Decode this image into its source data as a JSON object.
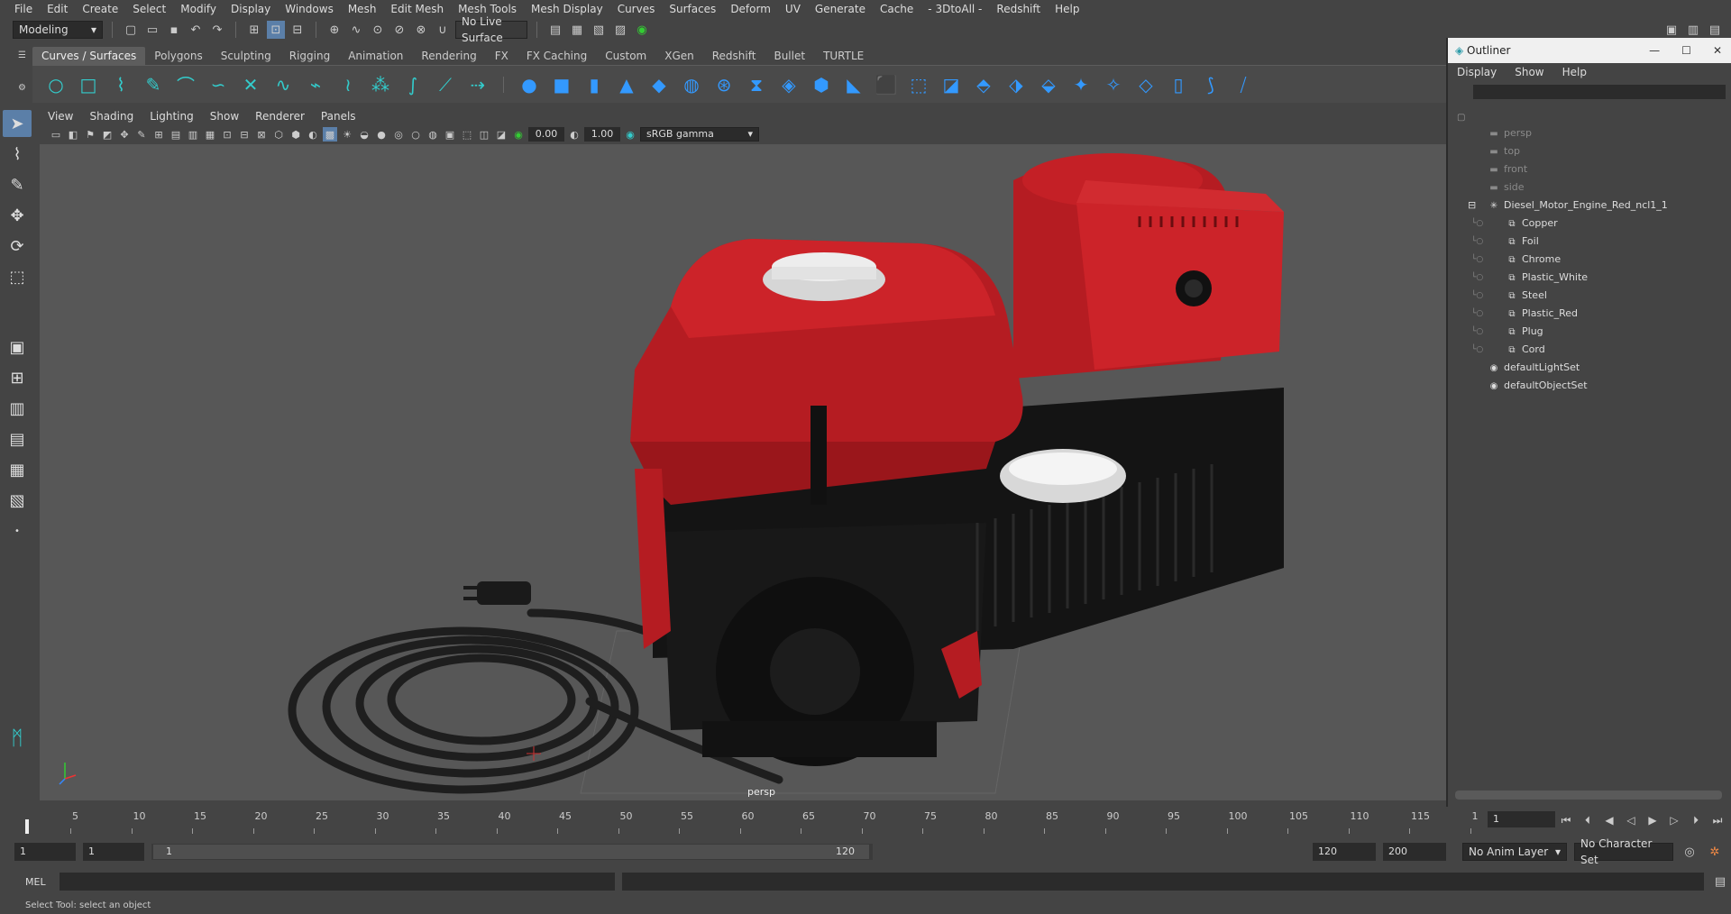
{
  "menubar": [
    "File",
    "Edit",
    "Create",
    "Select",
    "Modify",
    "Display",
    "Windows",
    "Mesh",
    "Edit Mesh",
    "Mesh Tools",
    "Mesh Display",
    "Curves",
    "Surfaces",
    "Deform",
    "UV",
    "Generate",
    "Cache",
    "- 3DtoAll -",
    "Redshift",
    "Help"
  ],
  "statusline": {
    "mode": "Modeling",
    "live_surface": "No Live Surface"
  },
  "shelf_tabs": [
    "Curves / Surfaces",
    "Polygons",
    "Sculpting",
    "Rigging",
    "Animation",
    "Rendering",
    "FX",
    "FX Caching",
    "Custom",
    "XGen",
    "Redshift",
    "Bullet",
    "TURTLE"
  ],
  "viewport": {
    "menu": [
      "View",
      "Shading",
      "Lighting",
      "Show",
      "Renderer",
      "Panels"
    ],
    "exposure": "0.00",
    "gamma": "1.00",
    "color_space": "sRGB gamma",
    "camera_label": "persp"
  },
  "outliner": {
    "title": "Outliner",
    "menu": [
      "Display",
      "Show",
      "Help"
    ],
    "cameras": [
      "persp",
      "top",
      "front",
      "side"
    ],
    "group": "Diesel_Motor_Engine_Red_ncl1_1",
    "children": [
      "Copper",
      "Foil",
      "Chrome",
      "Plastic_White",
      "Steel",
      "Plastic_Red",
      "Plug",
      "Cord"
    ],
    "sets": [
      "defaultLightSet",
      "defaultObjectSet"
    ]
  },
  "timeline": {
    "ticks": [
      "5",
      "10",
      "15",
      "20",
      "25",
      "30",
      "35",
      "40",
      "45",
      "50",
      "55",
      "60",
      "65",
      "70",
      "75",
      "80",
      "85",
      "90",
      "95",
      "100",
      "105",
      "110",
      "115",
      "1"
    ],
    "current_frame": "1",
    "current_frame_field": "1"
  },
  "range": {
    "start": "1",
    "playback_start": "1",
    "range_start_label": "1",
    "range_end_label": "120",
    "playback_end": "120",
    "end": "200",
    "anim_layer": "No Anim Layer",
    "char_set": "No Character Set"
  },
  "cmdline": {
    "label": "MEL"
  },
  "helpline": "Select Tool: select an object"
}
